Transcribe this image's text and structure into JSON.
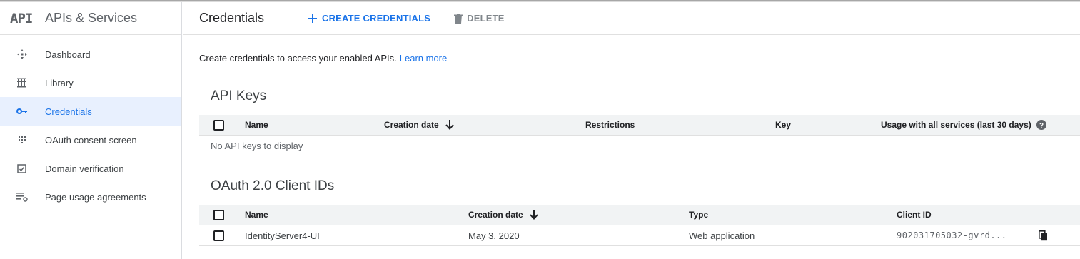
{
  "brand": {
    "logo": "API",
    "title": "APIs & Services"
  },
  "sidebar": {
    "items": [
      {
        "label": "Dashboard",
        "icon": "dashboard-icon"
      },
      {
        "label": "Library",
        "icon": "library-icon"
      },
      {
        "label": "Credentials",
        "icon": "key-icon",
        "active": true
      },
      {
        "label": "OAuth consent screen",
        "icon": "oauth-consent-icon"
      },
      {
        "label": "Domain verification",
        "icon": "domain-verification-icon"
      },
      {
        "label": "Page usage agreements",
        "icon": "page-usage-icon"
      }
    ]
  },
  "header": {
    "title": "Credentials",
    "create_label": "CREATE CREDENTIALS",
    "delete_label": "DELETE"
  },
  "main": {
    "intro_text": "Create credentials to access your enabled APIs.",
    "learn_more": "Learn more",
    "api_keys": {
      "title": "API Keys",
      "columns": [
        "Name",
        "Creation date",
        "Restrictions",
        "Key",
        "Usage with all services (last 30 days)"
      ],
      "empty_text": "No API keys to display"
    },
    "oauth": {
      "title": "OAuth 2.0 Client IDs",
      "columns": [
        "Name",
        "Creation date",
        "Type",
        "Client ID"
      ],
      "rows": [
        {
          "name": "IdentityServer4-UI",
          "date": "May 3, 2020",
          "type": "Web application",
          "client_id": "902031705032-gvrd..."
        }
      ]
    }
  },
  "colors": {
    "accent": "#1a73e8",
    "active_bg": "#e8f0fe",
    "header_bg": "#f1f3f4"
  }
}
